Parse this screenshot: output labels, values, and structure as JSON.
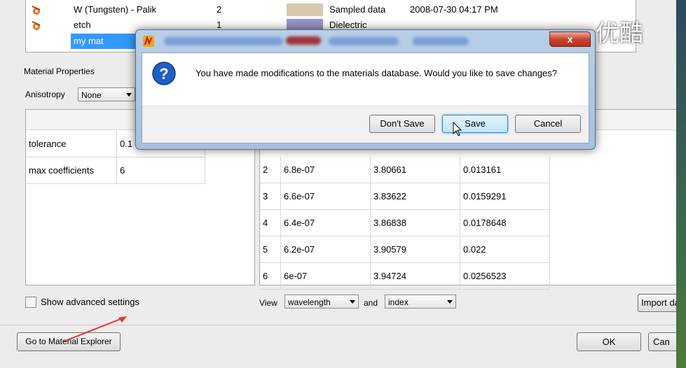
{
  "materials_list": {
    "rows": [
      {
        "name": "W (Tungsten) - Palik",
        "count": "2",
        "type": "Sampled data",
        "date": "2008-07-30 04:17 PM",
        "swatch": "#d8c8ae"
      },
      {
        "name": "etch",
        "count": "1",
        "type": "Dielectric",
        "date": "",
        "swatch": "#9a94c8"
      },
      {
        "name": "my mat",
        "count": "",
        "type": "",
        "date": "",
        "swatch": "#8c2a35"
      }
    ]
  },
  "material_properties": {
    "title": "Material Properties",
    "anisotropy_label": "Anisotropy",
    "anisotropy_value": "None",
    "fields": [
      {
        "label": "tolerance",
        "value": "0.1"
      },
      {
        "label": "max coefficients",
        "value": "6"
      }
    ],
    "show_advanced_label": "Show advanced settings"
  },
  "data_table": {
    "rows": [
      {
        "idx": "2",
        "wavelength": "6.8e-07",
        "index": "3.80661",
        "k": "0.013161"
      },
      {
        "idx": "3",
        "wavelength": "6.6e-07",
        "index": "3.83622",
        "k": "0.0159291"
      },
      {
        "idx": "4",
        "wavelength": "6.4e-07",
        "index": "3.86838",
        "k": "0.0178648"
      },
      {
        "idx": "5",
        "wavelength": "6.2e-07",
        "index": "3.90579",
        "k": "0.022"
      },
      {
        "idx": "6",
        "wavelength": "6e-07",
        "index": "3.94724",
        "k": "0.0256523"
      }
    ],
    "view_label": "View",
    "view_x": "wavelength",
    "and_label": "and",
    "view_y": "index",
    "import_label": "Import da"
  },
  "bottom": {
    "explorer_button": "Go to Material Explorer",
    "ok_button": "OK",
    "cancel_button": "Can"
  },
  "dialog": {
    "message": "You have made modifications to the materials database. Would you like to save changes?",
    "dont_save": "Don't Save",
    "save": "Save",
    "cancel": "Cancel",
    "close": "x"
  },
  "watermark": "优酷",
  "colors": {
    "selection": "#3399ff",
    "dialog_frame": "#a6c0de",
    "annotation_arrow": "#e8332a"
  }
}
